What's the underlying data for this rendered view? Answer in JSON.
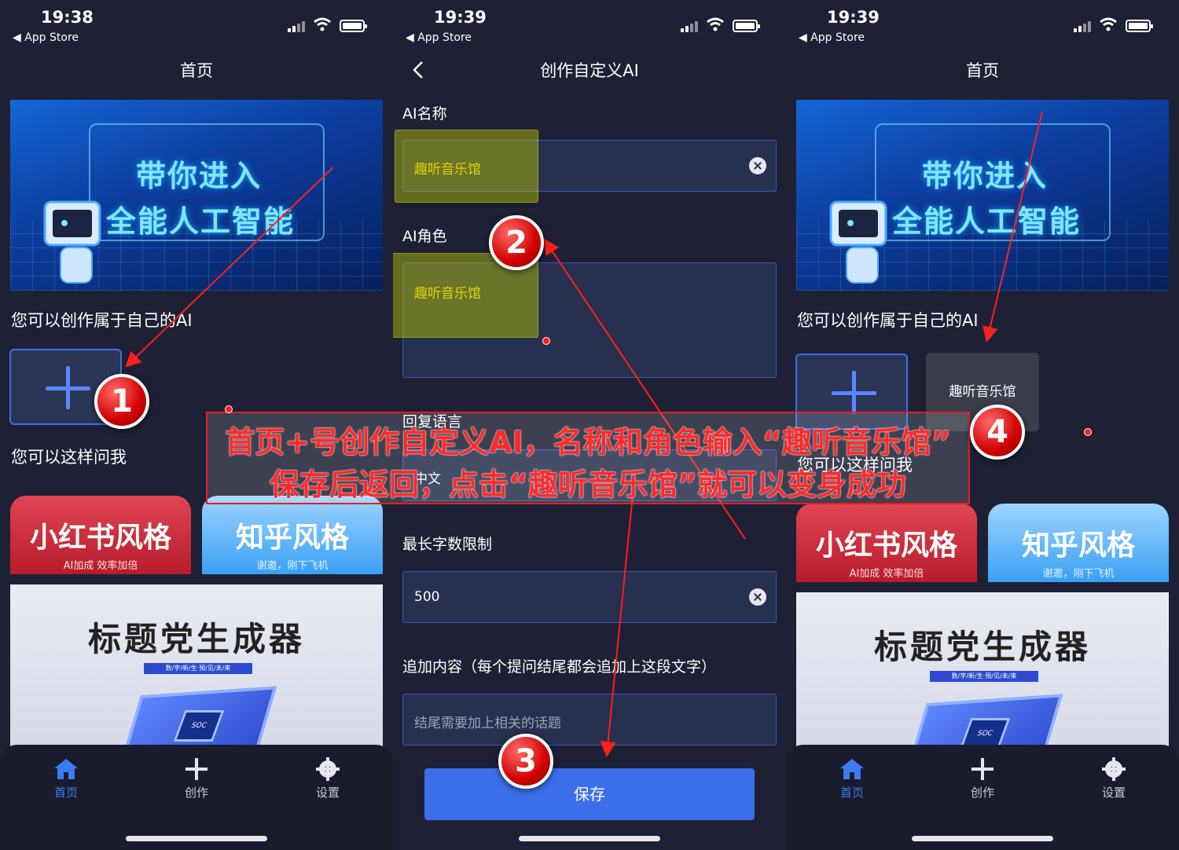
{
  "status": {
    "time_1": "19:38",
    "time_2": "19:39",
    "time_3": "19:39",
    "back_label": "◀ App Store"
  },
  "home": {
    "title": "首页",
    "banner_line1": "带你进入",
    "banner_line2": "全能人工智能",
    "create_prompt": "您可以创作属于自己的AI",
    "ask_prompt": "您可以这样问我",
    "custom_ai_name": "趣听音乐馆",
    "styles": [
      {
        "title": "小红书风格",
        "subtitle": "AI加成 效率加倍"
      },
      {
        "title": "知乎风格",
        "subtitle": "谢邀，刚下飞机"
      }
    ],
    "generator_title": "标题党生成器",
    "generator_tag": "数/字/新/生·预/见/未/来",
    "chip_label": "SOC"
  },
  "create": {
    "title": "创作自定义AI",
    "name_label": "AI名称",
    "name_value": "趣听音乐馆",
    "role_label": "AI角色",
    "role_value": "趣听音乐馆",
    "reply_lang_label": "回复语言",
    "reply_lang_value": "中文",
    "max_len_label": "最长字数限制",
    "max_len_value": "500",
    "append_label": "追加内容（每个提问结尾都会追加上这段文字）",
    "append_placeholder": "结尾需要加上相关的话题",
    "save_label": "保存"
  },
  "tabs": [
    {
      "label": "首页",
      "icon": "home-icon"
    },
    {
      "label": "创作",
      "icon": "plus-icon"
    },
    {
      "label": "设置",
      "icon": "gear-icon"
    }
  ],
  "annotation": {
    "line1": "首页+号创作自定义AI，名称和角色输入“趣听音乐馆”",
    "line2": "保存后返回，点击“趣听音乐馆”就可以变身成功",
    "badges": [
      "1",
      "2",
      "3",
      "4"
    ]
  },
  "colors": {
    "accent": "#3d6eea",
    "annotation_red": "#ff2a2a",
    "highlight_yellow": "#f4e400",
    "background": "#1e2135"
  }
}
